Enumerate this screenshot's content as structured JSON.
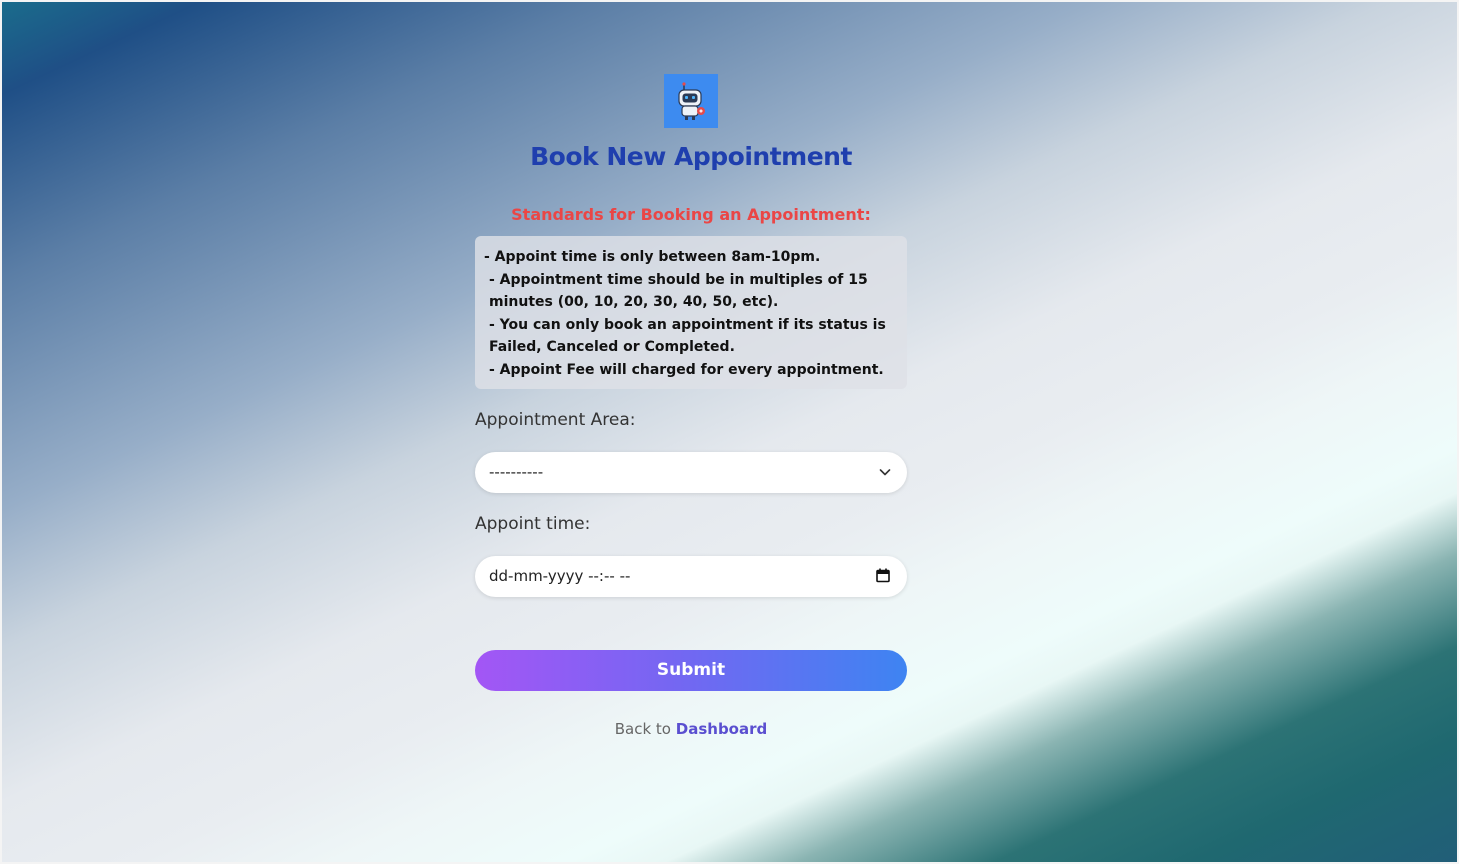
{
  "page": {
    "title": "Book New Appointment",
    "logo_icon": "robot-doctor-icon"
  },
  "standards": {
    "heading": "Standards for Booking an Appointment:",
    "rules": [
      "- Appoint time is only between 8am-10pm.",
      "- Appointment time should be in multiples of 15",
      "minutes (00, 10, 20, 30, 40, 50, etc).",
      "- You can only book an appointment if its status is",
      "Failed, Canceled or Completed.",
      "- Appoint Fee will charged for every appointment."
    ]
  },
  "form": {
    "area_label": "Appointment Area:",
    "area_value": "----------",
    "time_label": "Appoint time:",
    "time_placeholder": "dd-mm-yyyy --:-- --",
    "submit_label": "Submit"
  },
  "footer": {
    "back_prefix": "Back to",
    "back_link": "Dashboard"
  },
  "colors": {
    "title": "#1f3fae",
    "standards_heading": "#ea4646",
    "submit_start": "#a356f5",
    "submit_end": "#3e84f2",
    "link": "#5a4fd0"
  }
}
